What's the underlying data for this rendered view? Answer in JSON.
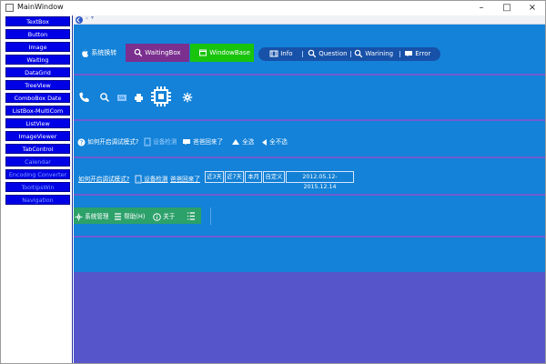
{
  "window": {
    "title": "MainWindow"
  },
  "sidebar": {
    "items": [
      {
        "label": "TextBox"
      },
      {
        "label": "Button"
      },
      {
        "label": "Image"
      },
      {
        "label": "Waiting"
      },
      {
        "label": "DataGrid"
      },
      {
        "label": "TreeView"
      },
      {
        "label": "ComboBox Date"
      },
      {
        "label": "ListBox-MultiCom"
      },
      {
        "label": "ListView"
      },
      {
        "label": "ImageViewer"
      },
      {
        "label": "TabControl"
      },
      {
        "label": "Calendar"
      },
      {
        "label": "Encoding Converter"
      },
      {
        "label": "TooltipsWin"
      },
      {
        "label": "Navigation"
      }
    ]
  },
  "row1": {
    "system_switch": "系统换转",
    "waiting_box": "WaitingBox",
    "window_base": "WindowBase",
    "pill": [
      {
        "label": "Info"
      },
      {
        "label": "Question"
      },
      {
        "label": "Warining"
      },
      {
        "label": "Error"
      }
    ]
  },
  "row3": {
    "help": "如何开启调试模式?",
    "device": "设备检测",
    "back": "爸爸回来了",
    "select_all": "全选",
    "select_none": "全不选"
  },
  "row4": {
    "help": "如何开启调试模式?",
    "device": "设备检测",
    "back": "爸爸回来了",
    "ranges": [
      "近3天",
      "近7天",
      "本月",
      "自定义"
    ],
    "date_range": "2012.05.12-2015.12.14"
  },
  "row5": {
    "system_manage": "系统管理",
    "help": "帮助(H)",
    "about": "关于"
  },
  "colors": {
    "accent": "#1382d8",
    "sidebar_active": "#0000e6",
    "purple": "#7b2f8f",
    "green": "#19c40d",
    "pill": "#1751a8"
  }
}
